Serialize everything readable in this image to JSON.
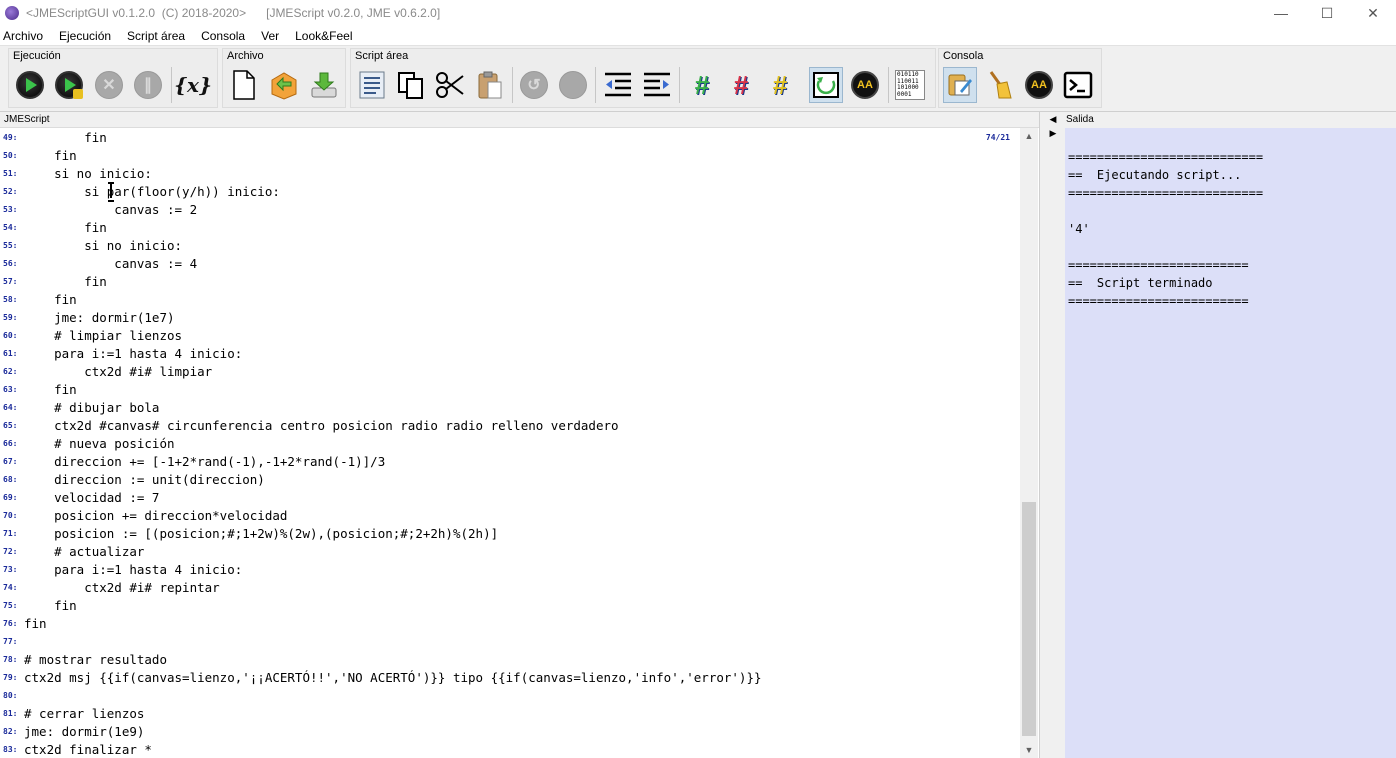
{
  "window": {
    "title": "<JMEScriptGUI v0.1.2.0  (C) 2018-2020>      [JMEScript v0.2.0, JME v0.6.2.0]",
    "minimize": "—",
    "maximize": "☐",
    "close": "✕"
  },
  "menu": [
    "Archivo",
    "Ejecución",
    "Script área",
    "Consola",
    "Ver",
    "Look&Feel"
  ],
  "toolbar": {
    "groups": {
      "ejecucion": "Ejecución",
      "archivo": "Archivo",
      "script_area": "Script área",
      "consola": "Consola"
    },
    "variable_icon_text": "{x}",
    "binary_icon_text": "010110\n110011\n101000\n0001"
  },
  "editor": {
    "panel_title": "JMEScript",
    "position": "74/21",
    "lines": [
      {
        "n": "49:",
        "text": "        fin"
      },
      {
        "n": "50:",
        "text": "    fin"
      },
      {
        "n": "51:",
        "text": "    si no inicio:"
      },
      {
        "n": "52:",
        "text": "        si par(floor(y/h)) inicio:"
      },
      {
        "n": "53:",
        "text": "            canvas := 2"
      },
      {
        "n": "54:",
        "text": "        fin"
      },
      {
        "n": "55:",
        "text": "        si no inicio:"
      },
      {
        "n": "56:",
        "text": "            canvas := 4"
      },
      {
        "n": "57:",
        "text": "        fin"
      },
      {
        "n": "58:",
        "text": "    fin"
      },
      {
        "n": "59:",
        "text": "    jme: dormir(1e7)"
      },
      {
        "n": "60:",
        "text": "    # limpiar lienzos"
      },
      {
        "n": "61:",
        "text": "    para i:=1 hasta 4 inicio:"
      },
      {
        "n": "62:",
        "text": "        ctx2d #i# limpiar"
      },
      {
        "n": "63:",
        "text": "    fin"
      },
      {
        "n": "64:",
        "text": "    # dibujar bola"
      },
      {
        "n": "65:",
        "text": "    ctx2d #canvas# circunferencia centro posicion radio radio relleno verdadero"
      },
      {
        "n": "66:",
        "text": "    # nueva posición"
      },
      {
        "n": "67:",
        "text": "    direccion += [-1+2*rand(-1),-1+2*rand(-1)]/3"
      },
      {
        "n": "68:",
        "text": "    direccion := unit(direccion)"
      },
      {
        "n": "69:",
        "text": "    velocidad := 7"
      },
      {
        "n": "70:",
        "text": "    posicion += direccion*velocidad"
      },
      {
        "n": "71:",
        "text": "    posicion := [(posicion;#;1+2w)%(2w),(posicion;#;2+2h)%(2h)]"
      },
      {
        "n": "72:",
        "text": "    # actualizar"
      },
      {
        "n": "73:",
        "text": "    para i:=1 hasta 4 inicio:"
      },
      {
        "n": "74:",
        "text": "        ctx2d #i# repintar"
      },
      {
        "n": "75:",
        "text": "    fin"
      },
      {
        "n": "76:",
        "text": "fin"
      },
      {
        "n": "77:",
        "text": ""
      },
      {
        "n": "78:",
        "text": "# mostrar resultado"
      },
      {
        "n": "79:",
        "text": "ctx2d msj {{if(canvas=lienzo,'¡¡ACERTÓ!!','NO ACERTÓ')}} tipo {{if(canvas=lienzo,'info','error')}}"
      },
      {
        "n": "80:",
        "text": ""
      },
      {
        "n": "81:",
        "text": "# cerrar lienzos"
      },
      {
        "n": "82:",
        "text": "jme: dormir(1e9)"
      },
      {
        "n": "83:",
        "text": "ctx2d finalizar *"
      }
    ]
  },
  "output": {
    "panel_title": "Salida",
    "lines": [
      "",
      "===========================",
      "==  Ejecutando script...",
      "===========================",
      "",
      "'4'",
      "",
      "=========================",
      "==  Script terminado",
      "========================="
    ]
  },
  "colors": {
    "line_number": "#1a2a9a",
    "output_bg": "#dcdff8",
    "run_green": "#3bc44b"
  }
}
